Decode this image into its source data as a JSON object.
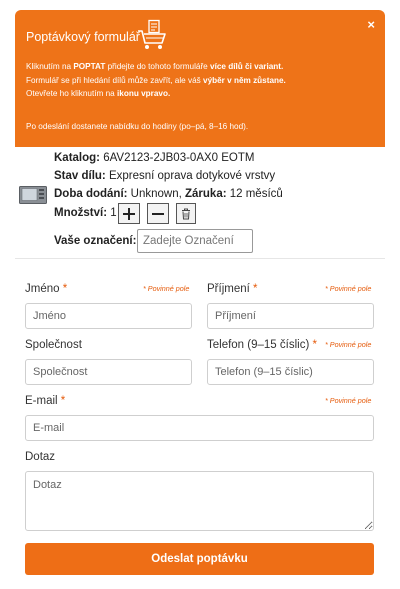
{
  "banner": {
    "title": "Poptávkový formulář",
    "close_symbol": "×",
    "line1_a": "Kliknutím na ",
    "line1_b": "POPTAT",
    "line1_c": " přidejte do tohoto formuláře ",
    "line1_d": "více dílů či variant.",
    "line2_a": "Formulář se při hledání dílů může zavřít, ale váš ",
    "line2_b": "výběr v něm zůstane.",
    "line3_a": "Otevřete ho kliknutím na ",
    "line3_b": "ikonu vpravo.",
    "note": "Po odeslání dostanete nabídku do hodiny (po–pá, 8–16 hod)."
  },
  "product": {
    "catalog_label": "Katalog:",
    "catalog_value": " 6AV2123-2JB03-0AX0 EOTM",
    "state_label": "Stav dílu:",
    "state_value": " Expresní oprava dotykové vrstvy",
    "delivery_label": "Doba dodání:",
    "delivery_value": " Unknown, ",
    "warranty_label": "Záruka:",
    "warranty_value": " 12 měsíců",
    "qty_label": "Množství:",
    "qty_value": " 1",
    "mark_label": "Vaše označení:",
    "mark_placeholder": "Zadejte Označení"
  },
  "form": {
    "required_note": "* Povinné pole",
    "star": "*",
    "first_name_label": "Jméno",
    "first_name_placeholder": "Jméno",
    "last_name_label": "Příjmení",
    "last_name_placeholder": "Příjmení",
    "company_label": "Společnost",
    "company_placeholder": "Společnost",
    "phone_label": "Telefon (9–15 číslic)",
    "phone_placeholder": "Telefon (9–15 číslic)",
    "email_label": "E-mail",
    "email_placeholder": "E-mail",
    "question_label": "Dotaz",
    "question_placeholder": "Dotaz",
    "submit_label": "Odeslat poptávku"
  },
  "colors": {
    "accent": "#ee7318",
    "required": "#e55a0a"
  },
  "icons": [
    "shopping-cart-icon",
    "close-icon",
    "plus-icon",
    "minus-icon",
    "trash-icon",
    "product-image"
  ]
}
